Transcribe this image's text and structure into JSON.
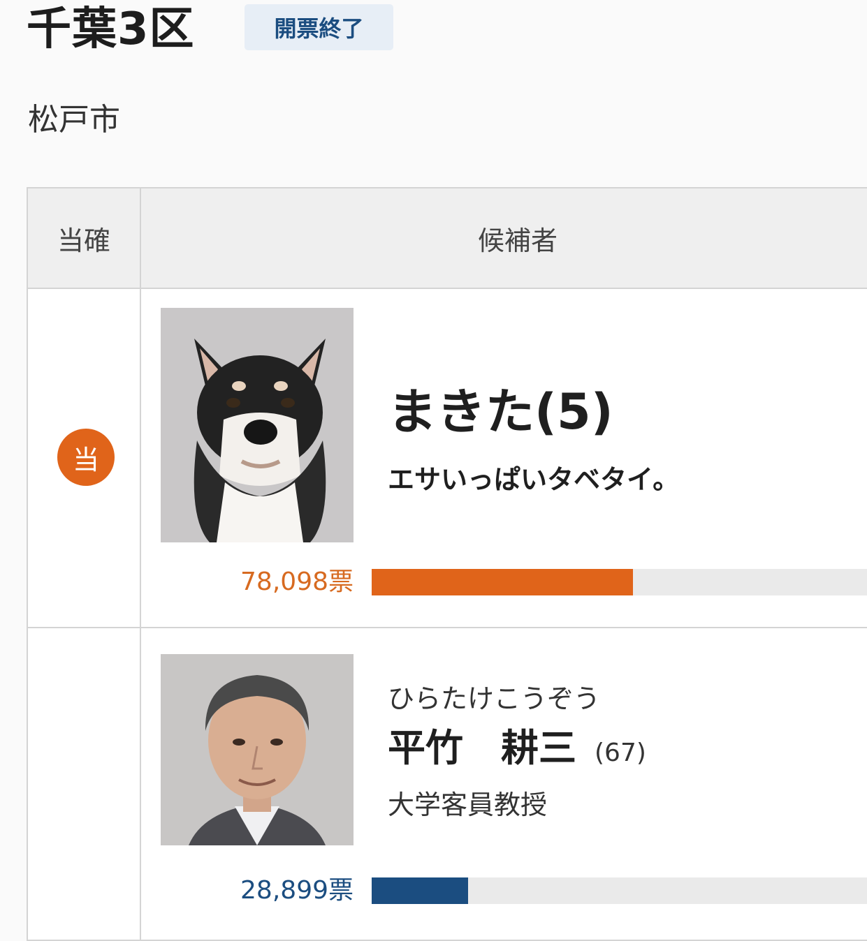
{
  "header": {
    "district": "千葉3区",
    "status": "開票終了"
  },
  "region": "松戸市",
  "table": {
    "col_elected": "当確",
    "col_candidate": "候補者",
    "candidates": [
      {
        "elected_mark": "当",
        "name": "まきた(5)",
        "slogan": "エサいっぱいタベタイ。",
        "photo": "shiba-dog-photo",
        "votes_label": "78,098票",
        "votes": 78098,
        "bar_fraction": 0.5,
        "color": "#e0641a"
      },
      {
        "kana": "ひらたけこうぞう",
        "name": "平竹　耕三",
        "age": "(67)",
        "occupation": "大学客員教授",
        "photo": "candidate-portrait-photo",
        "votes_label": "28,899票",
        "votes": 28899,
        "bar_fraction": 0.185,
        "color": "#1b4d80"
      }
    ]
  }
}
